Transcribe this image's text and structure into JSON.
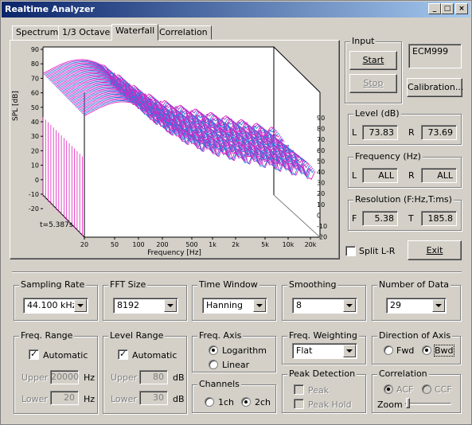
{
  "window": {
    "title": "Realtime Analyzer",
    "controls": [
      "_",
      "□",
      "×"
    ]
  },
  "tabs": [
    "Spectrum",
    "1/3 Octave",
    "Waterfall",
    "Correlation"
  ],
  "active_tab": "Waterfall",
  "chart": {
    "ylabel": "SPL [dB]",
    "left_ticks": [
      "90",
      "80",
      "70",
      "60",
      "50",
      "40",
      "30",
      "20",
      "10",
      "0",
      "-10",
      "-20"
    ],
    "right_ticks": [
      "90",
      "80",
      "70",
      "60",
      "50",
      "40",
      "30",
      "20",
      "10",
      "0",
      "-10",
      "-20"
    ],
    "x_ticks": [
      "20",
      "50",
      "100",
      "200",
      "500",
      "1k",
      "2k",
      "5k",
      "10k",
      "20k"
    ],
    "xlabel": "Frequency [Hz]",
    "time_label": "t=5.387s",
    "colors": {
      "trace_a": "#e020c0",
      "trace_b": "#2080e0",
      "trace_c": "#a040d0"
    }
  },
  "input": {
    "label": "Input",
    "start": "Start",
    "stop": "Stop",
    "device": "ECM999",
    "calibration": "Calibration..."
  },
  "level": {
    "label": "Level (dB)",
    "l_label": "L",
    "l_value": "73.83",
    "r_label": "R",
    "r_value": "73.69"
  },
  "frequency": {
    "label": "Frequency (Hz)",
    "l_label": "L",
    "l_value": "ALL",
    "r_label": "R",
    "r_value": "ALL"
  },
  "resolution": {
    "label": "Resolution (F:Hz,T:ms)",
    "f_label": "F",
    "f_value": "5.38",
    "t_label": "T",
    "t_value": "185.8"
  },
  "split": {
    "label": "Split L-R",
    "checked": false
  },
  "exit": "Exit",
  "sampling_rate": {
    "label": "Sampling Rate",
    "value": "44.100 kHz"
  },
  "fft_size": {
    "label": "FFT Size",
    "value": "8192"
  },
  "time_window": {
    "label": "Time Window",
    "value": "Hanning"
  },
  "smoothing": {
    "label": "Smoothing",
    "value": "8"
  },
  "number_of_data": {
    "label": "Number of Data",
    "value": "29"
  },
  "freq_range": {
    "label": "Freq. Range",
    "auto": "Automatic",
    "upper_label": "Upper",
    "upper_value": "20000",
    "upper_unit": "Hz",
    "lower_label": "Lower",
    "lower_value": "20",
    "lower_unit": "Hz"
  },
  "level_range": {
    "label": "Level Range",
    "auto": "Automatic",
    "upper_label": "Upper",
    "upper_value": "80",
    "upper_unit": "dB",
    "lower_label": "Lower",
    "lower_value": "30",
    "lower_unit": "dB"
  },
  "freq_axis": {
    "label": "Freq. Axis",
    "log": "Logarithm",
    "lin": "Linear",
    "selected": "Logarithm"
  },
  "channels": {
    "label": "Channels",
    "ch1": "1ch",
    "ch2": "2ch",
    "selected": "2ch"
  },
  "freq_weighting": {
    "label": "Freq. Weighting",
    "value": "Flat"
  },
  "peak_detection": {
    "label": "Peak Detection",
    "peak": "Peak",
    "peak_hold": "Peak Hold"
  },
  "direction": {
    "label": "Direction of Axis",
    "fwd": "Fwd",
    "bwd": "Bwd",
    "selected": "Bwd"
  },
  "correlation": {
    "label": "Correlation",
    "acf": "ACF",
    "ccf": "CCF",
    "zoom": "Zoom"
  }
}
